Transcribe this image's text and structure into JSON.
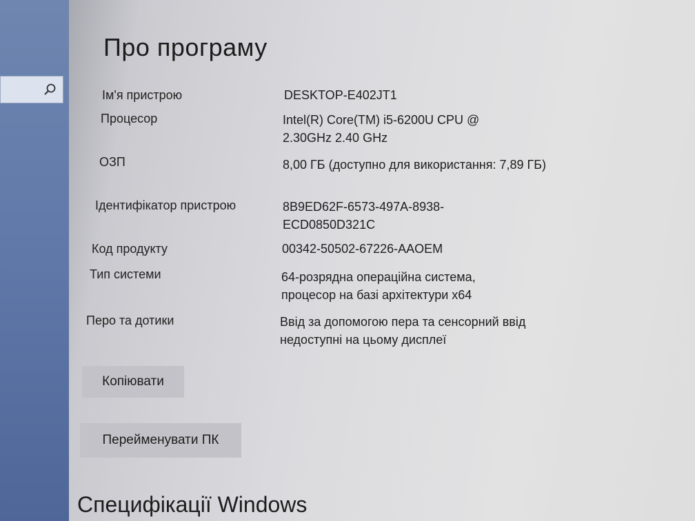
{
  "page_title": "Про програму",
  "specs": [
    {
      "label": "Ім'я пристрою",
      "value": "DESKTOP-E402JT1"
    },
    {
      "label": "Процесор",
      "value": "Intel(R) Core(TM) i5-6200U CPU @ 2.30GHz   2.40 GHz"
    },
    {
      "label": "ОЗП",
      "value": "8,00 ГБ (доступно для використання: 7,89 ГБ)"
    },
    {
      "label": "Ідентифікатор пристрою",
      "value": "8B9ED62F-6573-497A-8938-ECD0850D321C"
    },
    {
      "label": "Код продукту",
      "value": "00342-50502-67226-AAOEM"
    },
    {
      "label": "Тип системи",
      "value": "64-розрядна операційна система, процесор на базі архітектури x64"
    },
    {
      "label": "Перо та дотики",
      "value": "Ввід за допомогою пера та сенсорний ввід недоступні на цьому дисплеї"
    }
  ],
  "buttons": {
    "copy_label": "Копіювати",
    "rename_label": "Перейменувати ПК"
  },
  "section_title": "Специфікації Windows",
  "icons": {
    "search": "search-icon"
  },
  "colors": {
    "sidebar": "#5f78a8",
    "button_bg": "#c2c2c8"
  }
}
